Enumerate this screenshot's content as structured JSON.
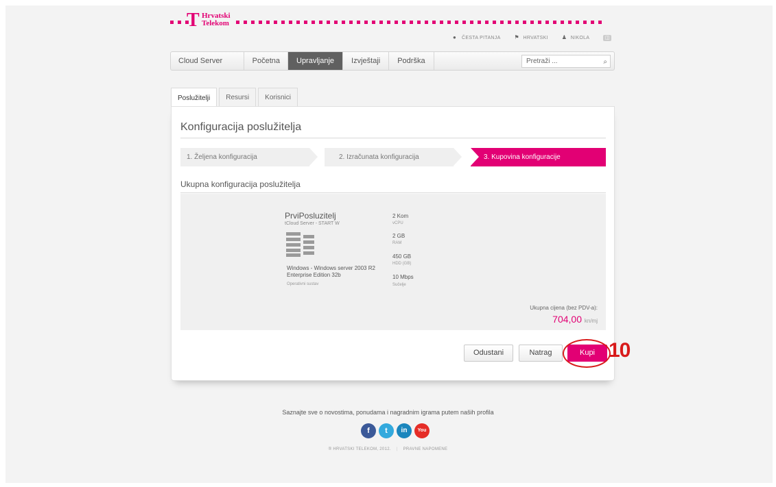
{
  "brand": {
    "name_line1": "Hrvatski",
    "name_line2": "Telekom",
    "logo_letter": "T",
    "color": "#e20074"
  },
  "util_nav": {
    "faq": "ČESTA PITANJA",
    "language": "HRVATSKI",
    "user": "NIKOLA",
    "logout_icon": "logout-icon"
  },
  "navbar": {
    "brand": "Cloud Server",
    "items": [
      "Početna",
      "Upravljanje",
      "Izvještaji",
      "Podrška"
    ],
    "active": "Upravljanje",
    "search_placeholder": "Pretraži ..."
  },
  "tabs": {
    "items": [
      "Poslužitelji",
      "Resursi",
      "Korisnici"
    ],
    "active": "Poslužitelji"
  },
  "page": {
    "title": "Konfiguracija poslužitelja",
    "steps": [
      "1. Željena konfiguracija",
      "2. Izračunata konfiguracija",
      "3. Kupovina konfiguracije"
    ],
    "active_step": 3,
    "section_title": "Ukupna konfiguracija poslužitelja"
  },
  "server": {
    "name": "PrviPosluzitelj",
    "plan": "tCloud Server - START W",
    "os_name": "Windows - Windows server 2003 R2 Enterprise Edition 32b",
    "os_label": "Operativni sustav",
    "specs": [
      {
        "value": "2 Kom",
        "label": "vCPU"
      },
      {
        "value": "2 GB",
        "label": "RAM"
      },
      {
        "value": "450 GB",
        "label": "HDD (GB)"
      },
      {
        "value": "10 Mbps",
        "label": "Sučelje"
      }
    ]
  },
  "total": {
    "label": "Ukupna cijena (bez PDV-a):",
    "value": "704,00",
    "unit": "kn/mj"
  },
  "buttons": {
    "cancel": "Odustani",
    "back": "Natrag",
    "buy": "Kupi"
  },
  "annotation": {
    "number": "10"
  },
  "footer": {
    "text": "Saznajte sve o novostima, ponudama i nagradnim igrama putem naših profila",
    "social": [
      {
        "icon": "facebook-icon",
        "glyph": "f",
        "color": "#3b5998"
      },
      {
        "icon": "twitter-icon",
        "glyph": "t",
        "color": "#33a9dd"
      },
      {
        "icon": "linkedin-icon",
        "glyph": "in",
        "color": "#1b86bd"
      },
      {
        "icon": "youtube-icon",
        "glyph": "You",
        "color": "#e52d27"
      }
    ],
    "copyright": "® HRVATSKI TELEKOM, 2012.",
    "legal": "PRAVNE NAPOMENE"
  }
}
